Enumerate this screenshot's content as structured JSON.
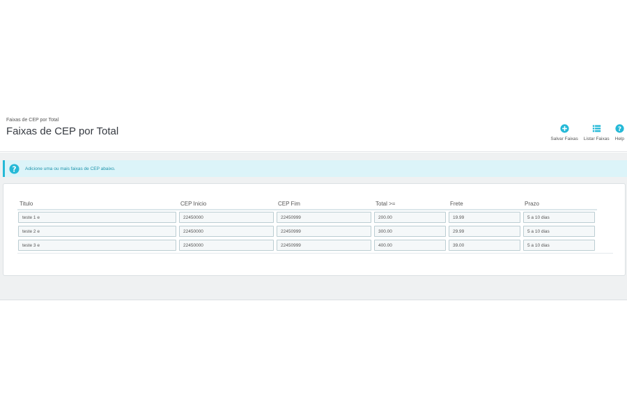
{
  "header": {
    "breadcrumb": "Faixas de CEP por Total",
    "title": "Faixas de CEP por Total",
    "toolbar": [
      {
        "label": "Salvar Faixas",
        "icon": "plus-circle-icon"
      },
      {
        "label": "Listar Faixas",
        "icon": "list-icon"
      },
      {
        "label": "Help",
        "icon": "help-circle-icon"
      }
    ]
  },
  "alert": {
    "text": "Adicione uma ou mais faixas de CEP abaixo.",
    "icon": "help-circle-icon"
  },
  "table": {
    "columns": [
      "Titulo",
      "CEP Inicio",
      "CEP Fim",
      "Total >=",
      "Frete",
      "Prazo"
    ],
    "rows": [
      [
        "teste 1 e",
        "22450000",
        "22450999",
        "200.00",
        "19.99",
        "5 a 10 dias"
      ],
      [
        "teste 2 e",
        "22450000",
        "22450999",
        "300.00",
        "29.99",
        "5 a 10 dias"
      ],
      [
        "teste 3 e",
        "22450000",
        "22450999",
        "400.00",
        "39.00",
        "5 a 10 dias"
      ]
    ]
  },
  "colors": {
    "accent": "#25b9d7",
    "alert_bg": "#dcf4f9",
    "background": "#eff1f2"
  }
}
